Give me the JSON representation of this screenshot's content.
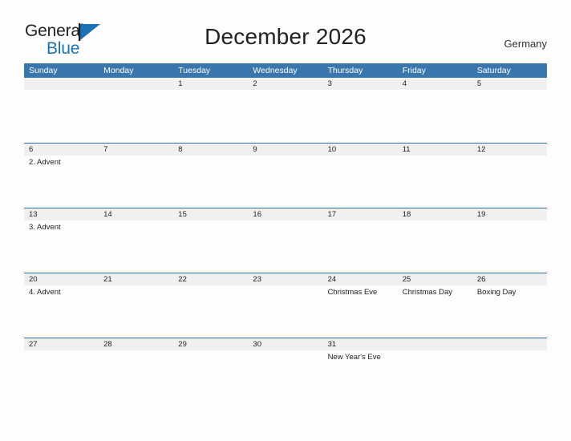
{
  "brand": {
    "name_part1": "General",
    "name_part2": "Blue",
    "accent_color": "#1b72b8"
  },
  "header": {
    "title": "December 2026",
    "country": "Germany"
  },
  "calendar": {
    "header_bg": "#3a76ae",
    "row_border": "#2f6fad",
    "day_band_bg": "#f0f0f0",
    "weekdays": [
      "Sunday",
      "Monday",
      "Tuesday",
      "Wednesday",
      "Thursday",
      "Friday",
      "Saturday"
    ],
    "weeks": [
      [
        {
          "number": "",
          "events": []
        },
        {
          "number": "",
          "events": []
        },
        {
          "number": "1",
          "events": []
        },
        {
          "number": "2",
          "events": []
        },
        {
          "number": "3",
          "events": []
        },
        {
          "number": "4",
          "events": []
        },
        {
          "number": "5",
          "events": []
        }
      ],
      [
        {
          "number": "6",
          "events": [
            "2. Advent"
          ]
        },
        {
          "number": "7",
          "events": []
        },
        {
          "number": "8",
          "events": []
        },
        {
          "number": "9",
          "events": []
        },
        {
          "number": "10",
          "events": []
        },
        {
          "number": "11",
          "events": []
        },
        {
          "number": "12",
          "events": []
        }
      ],
      [
        {
          "number": "13",
          "events": [
            "3. Advent"
          ]
        },
        {
          "number": "14",
          "events": []
        },
        {
          "number": "15",
          "events": []
        },
        {
          "number": "16",
          "events": []
        },
        {
          "number": "17",
          "events": []
        },
        {
          "number": "18",
          "events": []
        },
        {
          "number": "19",
          "events": []
        }
      ],
      [
        {
          "number": "20",
          "events": [
            "4. Advent"
          ]
        },
        {
          "number": "21",
          "events": []
        },
        {
          "number": "22",
          "events": []
        },
        {
          "number": "23",
          "events": []
        },
        {
          "number": "24",
          "events": [
            "Christmas Eve"
          ]
        },
        {
          "number": "25",
          "events": [
            "Christmas Day"
          ]
        },
        {
          "number": "26",
          "events": [
            "Boxing Day"
          ]
        }
      ],
      [
        {
          "number": "27",
          "events": []
        },
        {
          "number": "28",
          "events": []
        },
        {
          "number": "29",
          "events": []
        },
        {
          "number": "30",
          "events": []
        },
        {
          "number": "31",
          "events": [
            "New Year's Eve"
          ]
        },
        {
          "number": "",
          "events": []
        },
        {
          "number": "",
          "events": []
        }
      ]
    ]
  }
}
